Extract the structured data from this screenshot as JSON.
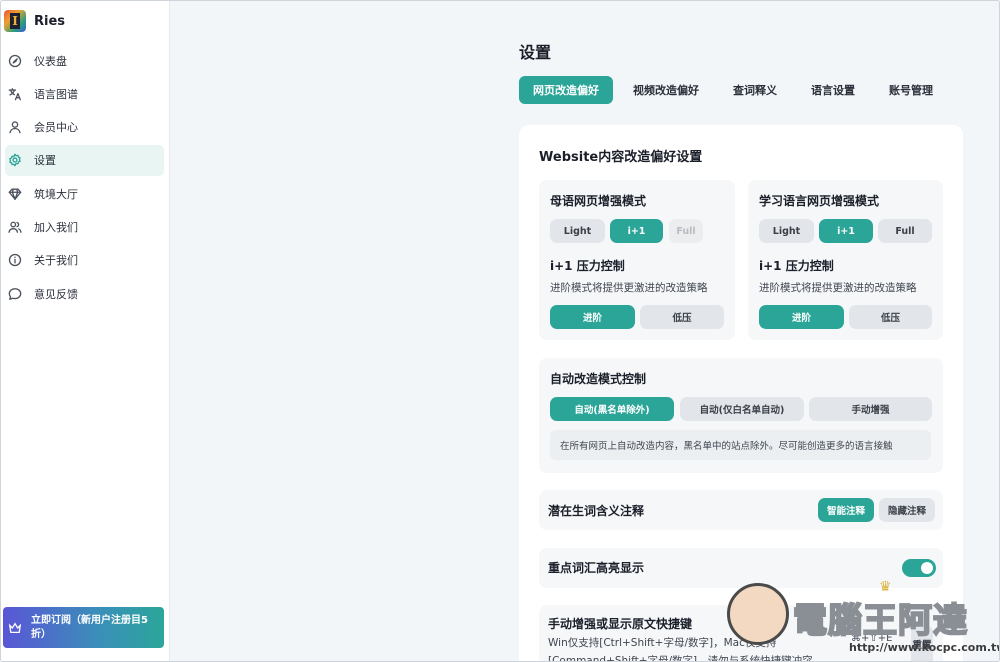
{
  "app": {
    "name": "Ries",
    "logo_letter": "I"
  },
  "sidebar": {
    "items": [
      {
        "label": "仪表盘",
        "icon": "dashboard-icon",
        "active": false
      },
      {
        "label": "语言图谱",
        "icon": "translate-icon",
        "active": false
      },
      {
        "label": "会员中心",
        "icon": "user-icon",
        "active": false
      },
      {
        "label": "设置",
        "icon": "gear-icon",
        "active": true
      },
      {
        "label": "筑境大厅",
        "icon": "diamond-icon",
        "active": false
      },
      {
        "label": "加入我们",
        "icon": "users-icon",
        "active": false
      },
      {
        "label": "关于我们",
        "icon": "info-icon",
        "active": false
      },
      {
        "label": "意见反馈",
        "icon": "chat-icon",
        "active": false
      }
    ],
    "subscribe_label": "立即订阅（新用户注册目5折）"
  },
  "page": {
    "title": "设置"
  },
  "tabs": [
    {
      "label": "网页改造偏好",
      "active": true
    },
    {
      "label": "视频改造偏好",
      "active": false
    },
    {
      "label": "查词释义",
      "active": false
    },
    {
      "label": "语言设置",
      "active": false
    },
    {
      "label": "账号管理",
      "active": false
    }
  ],
  "card": {
    "title": "Website内容改造偏好设置",
    "native": {
      "title": "母语网页增强模式",
      "modes": [
        "Light",
        "i+1",
        "Full"
      ],
      "selected_mode": "i+1",
      "pressure_title": "i+1 压力控制",
      "pressure_desc": "进阶模式将提供更激进的改造策略",
      "pressure_options": [
        "进阶",
        "低压"
      ],
      "selected_pressure": "进阶"
    },
    "learning": {
      "title": "学习语言网页增强模式",
      "modes": [
        "Light",
        "i+1",
        "Full"
      ],
      "selected_mode": "i+1",
      "pressure_title": "i+1 压力控制",
      "pressure_desc": "进阶模式将提供更激进的改造策略",
      "pressure_options": [
        "进阶",
        "低压"
      ],
      "selected_pressure": "进阶"
    },
    "auto": {
      "title": "自动改造模式控制",
      "options": [
        "自动(黑名单除外)",
        "自动(仅白名单自动)",
        "手动增强"
      ],
      "selected": "自动(黑名单除外)",
      "info": "在所有网页上自动改造内容，黑名单中的站点除外。尽可能创造更多的语言接触"
    },
    "annotation": {
      "label": "潜在生词含义注释",
      "options": [
        "智能注释",
        "隐藏注释"
      ],
      "selected": "智能注释"
    },
    "highlight": {
      "label": "重点词汇高亮显示",
      "enabled": true
    },
    "shortcut": {
      "label": "手动增强或显示原文快捷键",
      "desc_line1": "Win仅支持[Ctrl+Shift+字母/数字]，Mac仅支持",
      "desc_line2": "[Command+Shift+字母/数字]，请勿与系统快捷键冲突",
      "keys": "⌘+⇧+E",
      "reset_label": "重置"
    }
  },
  "watermark": {
    "text": "電腦王阿達",
    "url": "http://www.kocpc.com.tw"
  },
  "colors": {
    "accent": "#2aa597",
    "panel": "#f5f7f9",
    "background": "#f3f6f9"
  }
}
